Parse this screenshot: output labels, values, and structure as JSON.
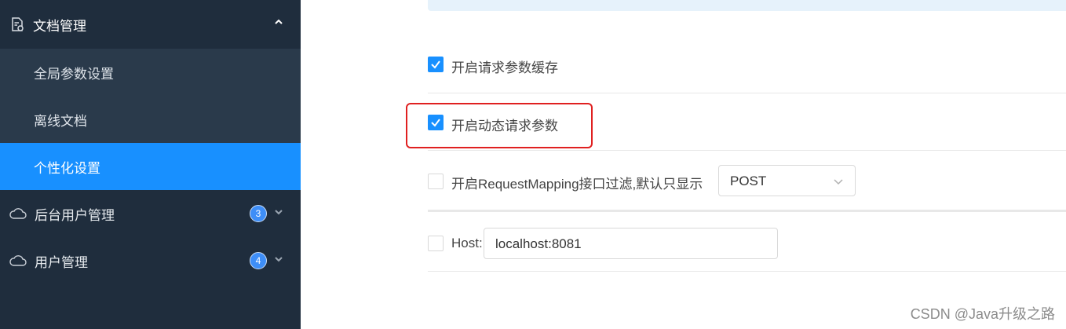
{
  "sidebar": {
    "doc_menu": {
      "label": "文档管理",
      "icon": "document-settings-icon"
    },
    "sub_items": [
      {
        "label": "全局参数设置",
        "active": false
      },
      {
        "label": "离线文档",
        "active": false
      },
      {
        "label": "个性化设置",
        "active": true
      }
    ],
    "menus": [
      {
        "label": "后台用户管理",
        "icon": "cloud-icon",
        "badge": "3"
      },
      {
        "label": "用户管理",
        "icon": "cloud-icon",
        "badge": "4"
      }
    ]
  },
  "settings": {
    "cache_label": "开启请求参数缓存",
    "cache_checked": true,
    "dynamic_label": "开启动态请求参数",
    "dynamic_checked": true,
    "mapping_label": "开启RequestMapping接口过滤,默认只显示",
    "mapping_checked": false,
    "method_value": "POST",
    "host_label": "Host:",
    "host_checked": false,
    "host_value": "localhost:8081"
  },
  "watermark": "CSDN @Java升级之路",
  "colors": {
    "sidebar_bg": "#1f2d3d",
    "accent": "#1890ff",
    "highlight": "#e02020"
  }
}
